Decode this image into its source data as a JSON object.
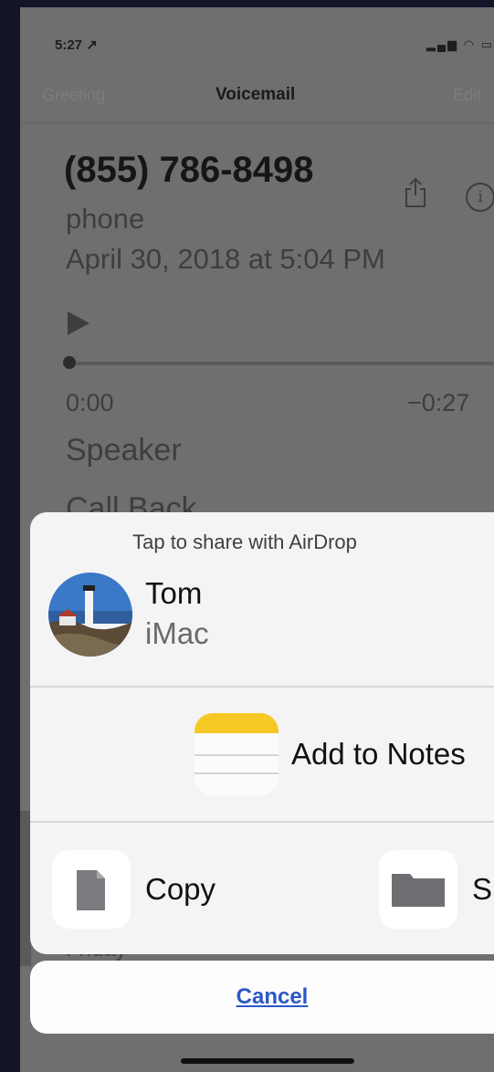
{
  "status_bar": {
    "time": "5:27 ↗"
  },
  "nav": {
    "left": "Greeting",
    "title": "Voicemail",
    "right": "Edit"
  },
  "voicemail": {
    "number": "(855) 786-8498",
    "label": "phone",
    "date": "April 30, 2018 at 5:04 PM",
    "time_elapsed": "0:00",
    "time_remaining": "−0:27",
    "progress": 0,
    "speaker": "Speaker",
    "call_back": "Call Back"
  },
  "share_sheet": {
    "airdrop_hint": "Tap to share with AirDrop",
    "contact": {
      "name": "Tom",
      "device": "iMac"
    },
    "app_action": "Add to Notes",
    "actions": [
      {
        "label": "Copy",
        "icon": "copy-icon"
      },
      {
        "label": "S",
        "icon": "folder-icon"
      }
    ],
    "cancel": "Cancel"
  },
  "peek_text": "Friday",
  "colors": {
    "dim_background": "#6f6f6f",
    "sheet": "#f4f4f4",
    "link": "#2a58c8",
    "notes_yellow": "#f6c823"
  }
}
